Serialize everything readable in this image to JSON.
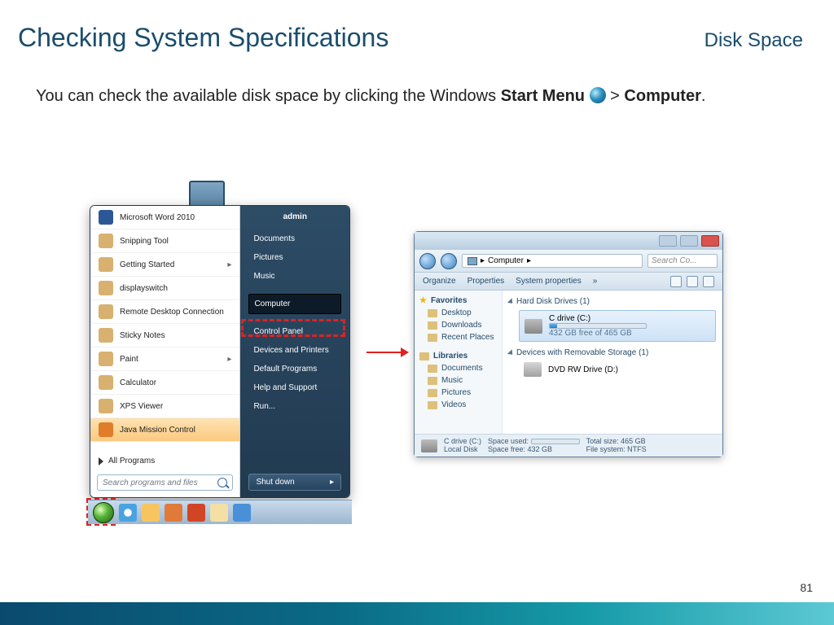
{
  "header": {
    "title": "Checking System Specifications",
    "subtitle": "Disk Space"
  },
  "intro": {
    "pre": "You can check the available disk space by clicking the Windows ",
    "bold1": "Start Menu",
    "mid": " > ",
    "bold2": "Computer",
    "post": "."
  },
  "startMenu": {
    "left": {
      "items": [
        {
          "label": "Microsoft Word 2010",
          "cls": "word"
        },
        {
          "label": "Snipping Tool"
        },
        {
          "label": "Getting Started",
          "chev": true
        },
        {
          "label": "displayswitch"
        },
        {
          "label": "Remote Desktop Connection"
        },
        {
          "label": "Sticky Notes"
        },
        {
          "label": "Paint",
          "chev": true
        },
        {
          "label": "Calculator"
        },
        {
          "label": "XPS Viewer"
        },
        {
          "label": "Java Mission Control",
          "highlight": true
        }
      ],
      "allPrograms": "All Programs",
      "searchPlaceholder": "Search programs and files"
    },
    "right": {
      "user": "admin",
      "links1": [
        "Documents",
        "Pictures",
        "Music"
      ],
      "selected": "Computer",
      "links2": [
        "Control Panel",
        "Devices and Printers",
        "Default Programs",
        "Help and Support",
        "Run..."
      ],
      "shutdown": "Shut down"
    }
  },
  "explorer": {
    "breadcrumb": "Computer",
    "searchPlaceholder": "Search Co...",
    "toolbar": {
      "organize": "Organize",
      "properties": "Properties",
      "sysprops": "System properties",
      "more": "»"
    },
    "side": {
      "favorites": "Favorites",
      "favItems": [
        "Desktop",
        "Downloads",
        "Recent Places"
      ],
      "libraries": "Libraries",
      "libItems": [
        "Documents",
        "Music",
        "Pictures",
        "Videos"
      ]
    },
    "main": {
      "cat1": "Hard Disk Drives (1)",
      "drive": {
        "name": "C drive (C:)",
        "free": "432 GB free of 465 GB"
      },
      "cat2": "Devices with Removable Storage (1)",
      "dvd": "DVD RW Drive (D:)"
    },
    "status": {
      "name": "C drive (C:)",
      "l1a": "Local Disk",
      "l2a": "Space used:",
      "l1b": "Space free: 432 GB",
      "l2b": "Total size: 465 GB",
      "l3": "File system: NTFS"
    }
  },
  "pageNumber": "81"
}
